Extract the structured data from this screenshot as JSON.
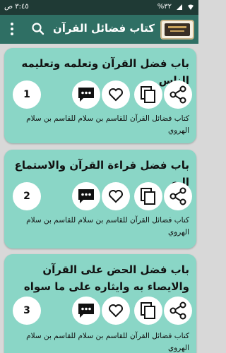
{
  "status_bar": {
    "time": "٣:٤٥ ص",
    "battery": "%٣٢"
  },
  "toolbar": {
    "title": "كتاب فضائل القرآن للقا...",
    "menu_icon": "overflow-menu-icon",
    "search_icon": "search-icon"
  },
  "cards": [
    {
      "title": "باب فضل القرآن وتعلمه وتعليمه الناس",
      "number": "1",
      "subtitle": "كتاب فضائل القرآن للقاسم بن سلام للقاسم بن سلام الهروي"
    },
    {
      "title": "باب فضل قراءة القرآن والاستماع اليه",
      "number": "2",
      "subtitle": "كتاب فضائل القرآن للقاسم بن سلام للقاسم بن سلام الهروي"
    },
    {
      "title": "باب فضل الحض على القرآن والايصاء به وايثاره على ما سواه",
      "number": "3",
      "subtitle": "كتاب فضائل القرآن للقاسم بن سلام للقاسم بن سلام الهروي"
    }
  ],
  "colors": {
    "toolbar": "#2f6f64",
    "status_bar": "#1f3a35",
    "card": "#8ad6c6"
  }
}
